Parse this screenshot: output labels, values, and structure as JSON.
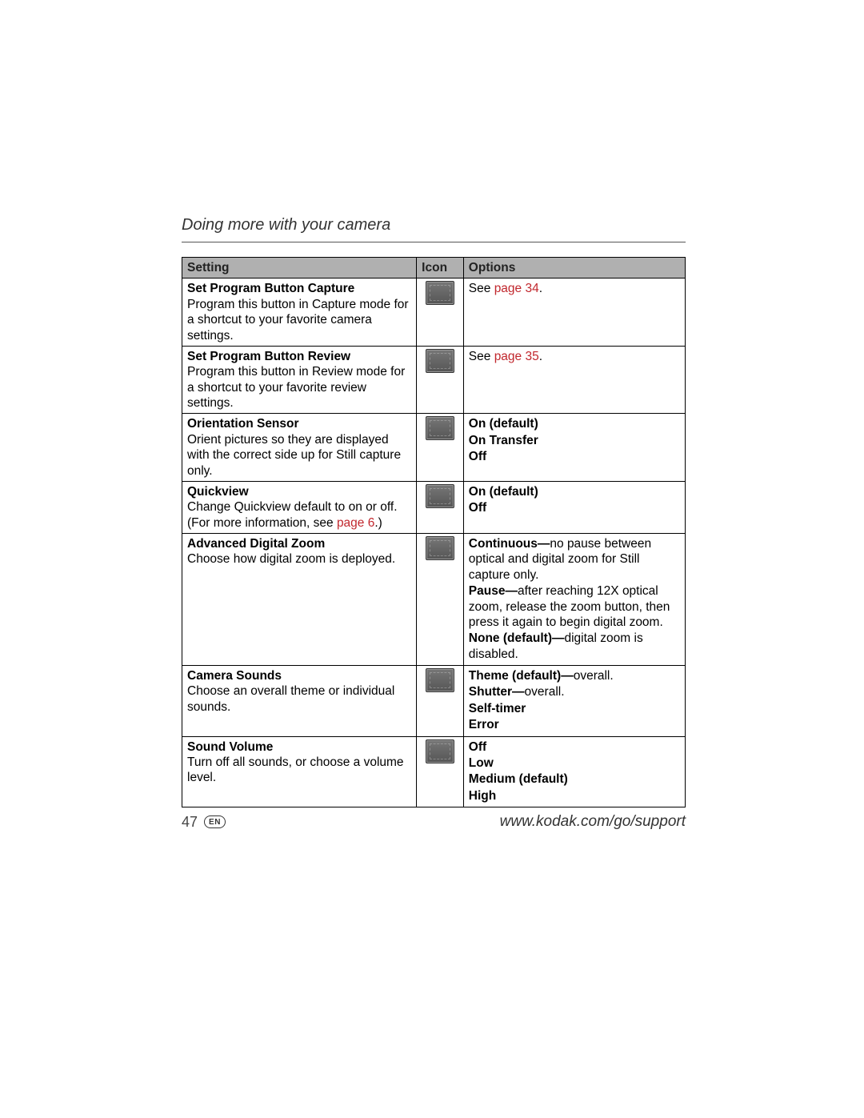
{
  "header": "Doing more with your camera",
  "table": {
    "headers": {
      "setting": "Setting",
      "icon": "Icon",
      "options": "Options"
    }
  },
  "rows": {
    "capture": {
      "title": "Set Program Button Capture",
      "desc": "Program this button in Capture mode for a shortcut to your favorite camera settings.",
      "see": "See ",
      "link": "page 34",
      "dot": "."
    },
    "review": {
      "title": "Set Program Button Review",
      "desc": "Program this button in Review mode for a shortcut to your favorite review settings.",
      "see": "See ",
      "link": "page 35",
      "dot": "."
    },
    "orient": {
      "title": "Orientation Sensor",
      "desc": "Orient pictures so they are displayed with the correct side up for Still capture only.",
      "opt1": "On (default)",
      "opt2": "On Transfer",
      "opt3": "Off"
    },
    "quickview": {
      "title": "Quickview",
      "desc1": "Change Quickview default to on or off. (For more information, see ",
      "link": "page 6",
      "desc2": ".)",
      "opt1": "On (default)",
      "opt2": "Off"
    },
    "zoom": {
      "title": "Advanced Digital Zoom",
      "desc": "Choose how digital zoom is deployed.",
      "c_label": "Continuous—",
      "c_text": "no pause between optical and digital zoom for Still capture only.",
      "p_label": "Pause—",
      "p_text": "after reaching 12X optical zoom, release the zoom button, then press it again to begin digital zoom.",
      "n_label": "None (default)—",
      "n_text": "digital zoom is disabled."
    },
    "sounds": {
      "title": "Camera Sounds",
      "desc": "Choose an overall theme or individual sounds.",
      "t_label": "Theme (default)—",
      "t_text": "overall.",
      "s_label": "Shutter—",
      "s_text": "overall.",
      "self": "Self-timer",
      "err": "Error"
    },
    "volume": {
      "title": "Sound Volume",
      "desc": "Turn off all sounds, or choose a volume level.",
      "opt1": "Off",
      "opt2": "Low",
      "opt3": "Medium (default)",
      "opt4": "High"
    }
  },
  "footer": {
    "page": "47",
    "lang": "EN",
    "url": "www.kodak.com/go/support"
  }
}
